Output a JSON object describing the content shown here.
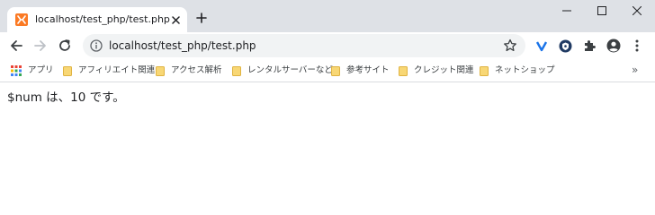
{
  "tab": {
    "title": "localhost/test_php/test.php",
    "favicon": "xampp-logo-icon"
  },
  "toolbar": {
    "url": "localhost/test_php/test.php"
  },
  "bookmarks": {
    "items": [
      {
        "label": "アプリ",
        "icon": "apps-grid-icon"
      },
      {
        "label": "アフィリエイト関連",
        "icon": "folder-icon"
      },
      {
        "label": "アクセス解析",
        "icon": "folder-icon"
      },
      {
        "label": "レンタルサーバーなど",
        "icon": "folder-icon"
      },
      {
        "label": "参考サイト",
        "icon": "folder-icon"
      },
      {
        "label": "クレジット関連",
        "icon": "folder-icon"
      },
      {
        "label": "ネットショップ",
        "icon": "folder-icon"
      }
    ],
    "overflow": "»"
  },
  "page": {
    "output_text": "$num は、10 です。"
  },
  "colors": {
    "tabstrip_bg": "#dee1e6",
    "omnibox_bg": "#f1f3f4",
    "favicon_orange": "#fb7a24",
    "folder_yellow": "#f8d775",
    "extension_blue": "#1a73e8",
    "extension_navy": "#203a63"
  }
}
